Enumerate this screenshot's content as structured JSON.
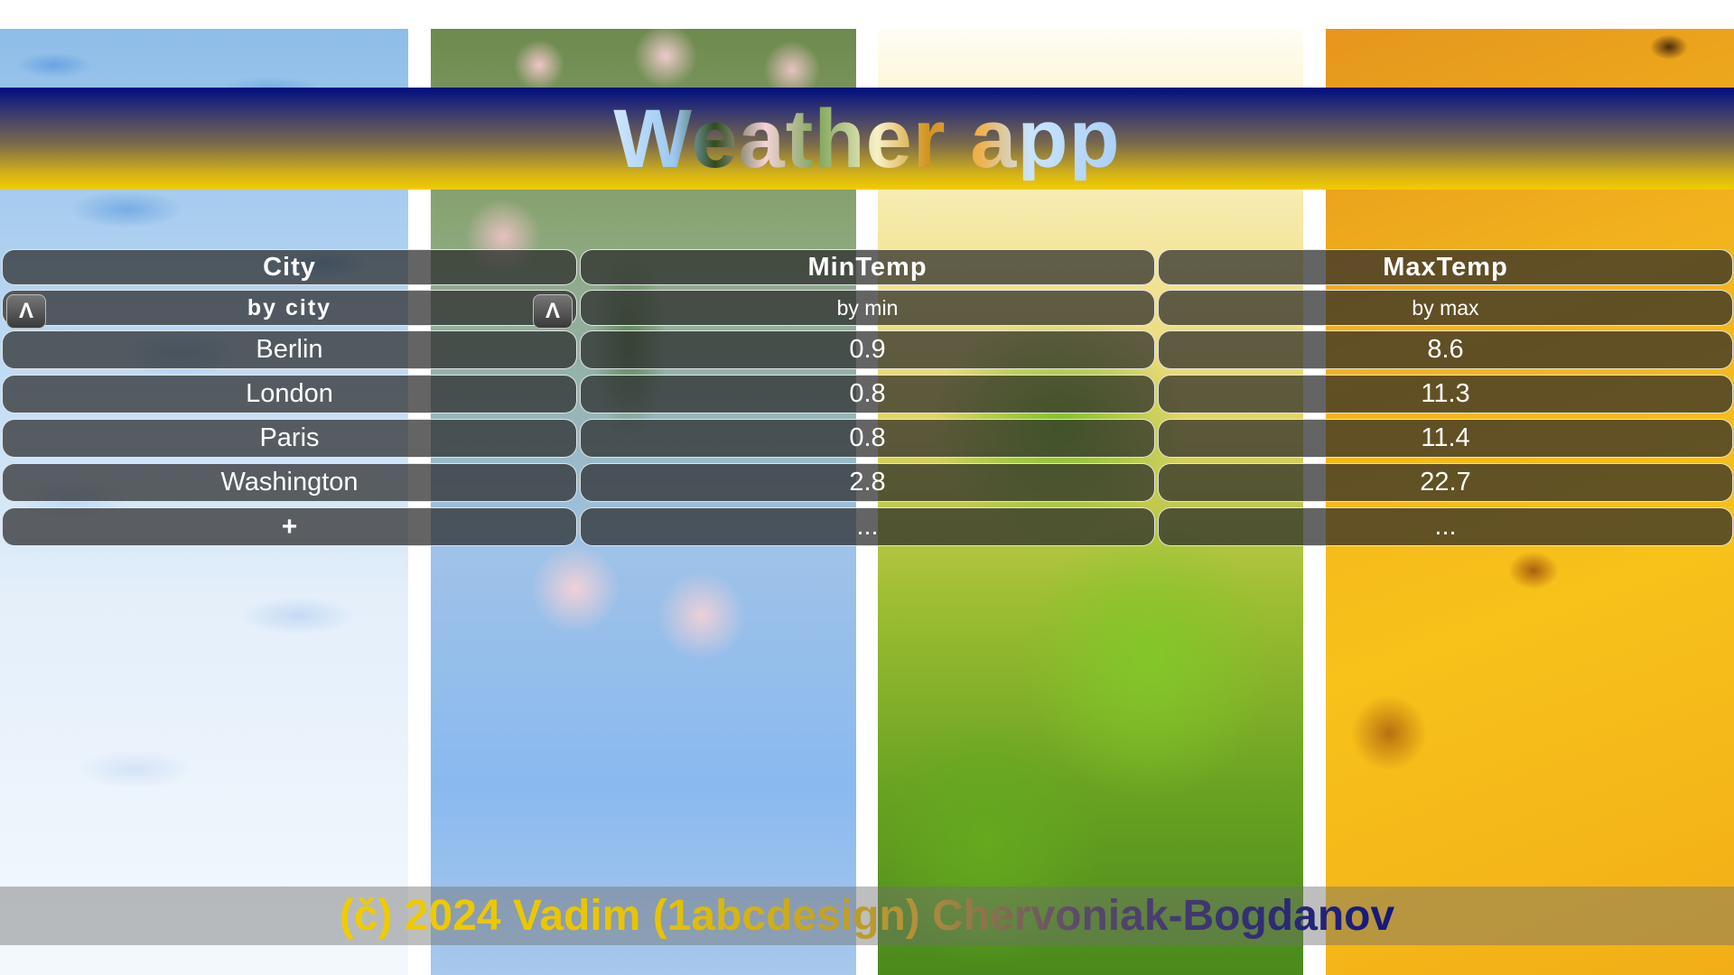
{
  "header": {
    "title": "Weather app"
  },
  "table": {
    "columns": [
      {
        "title": "City",
        "sort_label": "by city",
        "sort_asc_icon": "Λ",
        "sort_desc_icon": "Λ"
      },
      {
        "title": "MinTemp",
        "sort_label": "by min"
      },
      {
        "title": "MaxTemp",
        "sort_label": "by max"
      }
    ],
    "rows": [
      {
        "city": "Berlin",
        "min": "0.9",
        "max": "8.6"
      },
      {
        "city": "London",
        "min": "0.8",
        "max": "11.3"
      },
      {
        "city": "Paris",
        "min": "0.8",
        "max": "11.4"
      },
      {
        "city": "Washington",
        "min": "2.8",
        "max": "22.7"
      }
    ],
    "add_row": {
      "city": "+",
      "min": "...",
      "max": "..."
    }
  },
  "footer": {
    "text": "(č) 2024 Vadim (1abcdesign) Chervoniak-Bogdanov"
  },
  "colors": {
    "header_top": "#000e80",
    "header_bottom": "#f2cc00",
    "cell_bg": "#282828"
  }
}
